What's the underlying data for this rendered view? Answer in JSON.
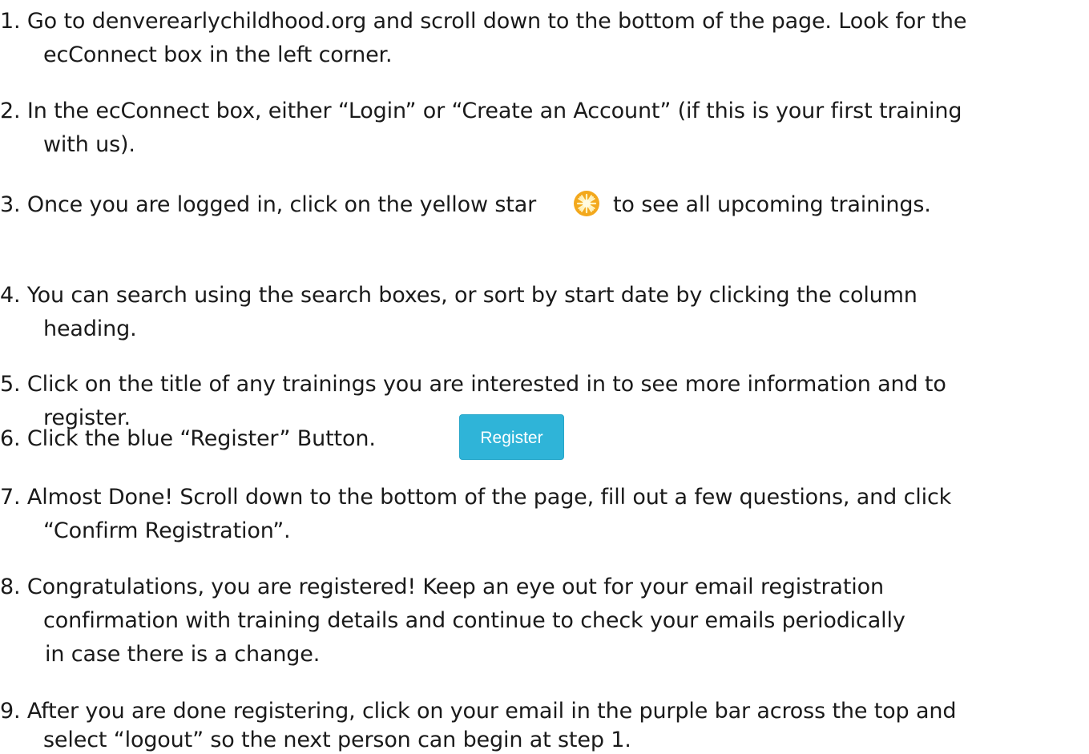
{
  "steps": [
    {
      "lines": [
        "1. Go to denverearlychildhood.org and scroll down to the bottom of the page. Look for the",
        "ecConnect box in the left corner."
      ]
    },
    {
      "lines": [
        "2. In the ecConnect box, either “Login” or “Create an Account” (if this is your first training",
        "with us)."
      ]
    },
    {
      "before_icon": "3. Once you are logged in, click on the yellow star",
      "icon": "yellow-star-icon",
      "after_icon": "to see all upcoming trainings."
    },
    {
      "lines": [
        "4. You can search using the search boxes, or sort by start date by clicking the column",
        "heading."
      ]
    },
    {
      "lines": [
        "5. Click on the title of any trainings you are interested in to see more information and to",
        "register."
      ]
    },
    {
      "text": "6. Click the blue “Register” Button.",
      "button_label": "Register"
    },
    {
      "lines": [
        "7. Almost Done! Scroll down to the bottom of the page, fill out a few questions, and click",
        "“Confirm Registration”."
      ]
    },
    {
      "lines": [
        "8. Congratulations, you are registered! Keep an eye out for your email registration",
        "confirmation with training details and continue to check your emails periodically",
        "in case there is a change."
      ]
    },
    {
      "lines": [
        "9. After you are done registering, click on your email in the purple bar across the top and",
        "select “logout” so the next person can begin at step 1."
      ]
    }
  ],
  "colors": {
    "star_fill": "#f3a81c",
    "star_center": "#fff3c0",
    "button_bg": "#2fb4d8",
    "button_text": "#ffffff"
  }
}
